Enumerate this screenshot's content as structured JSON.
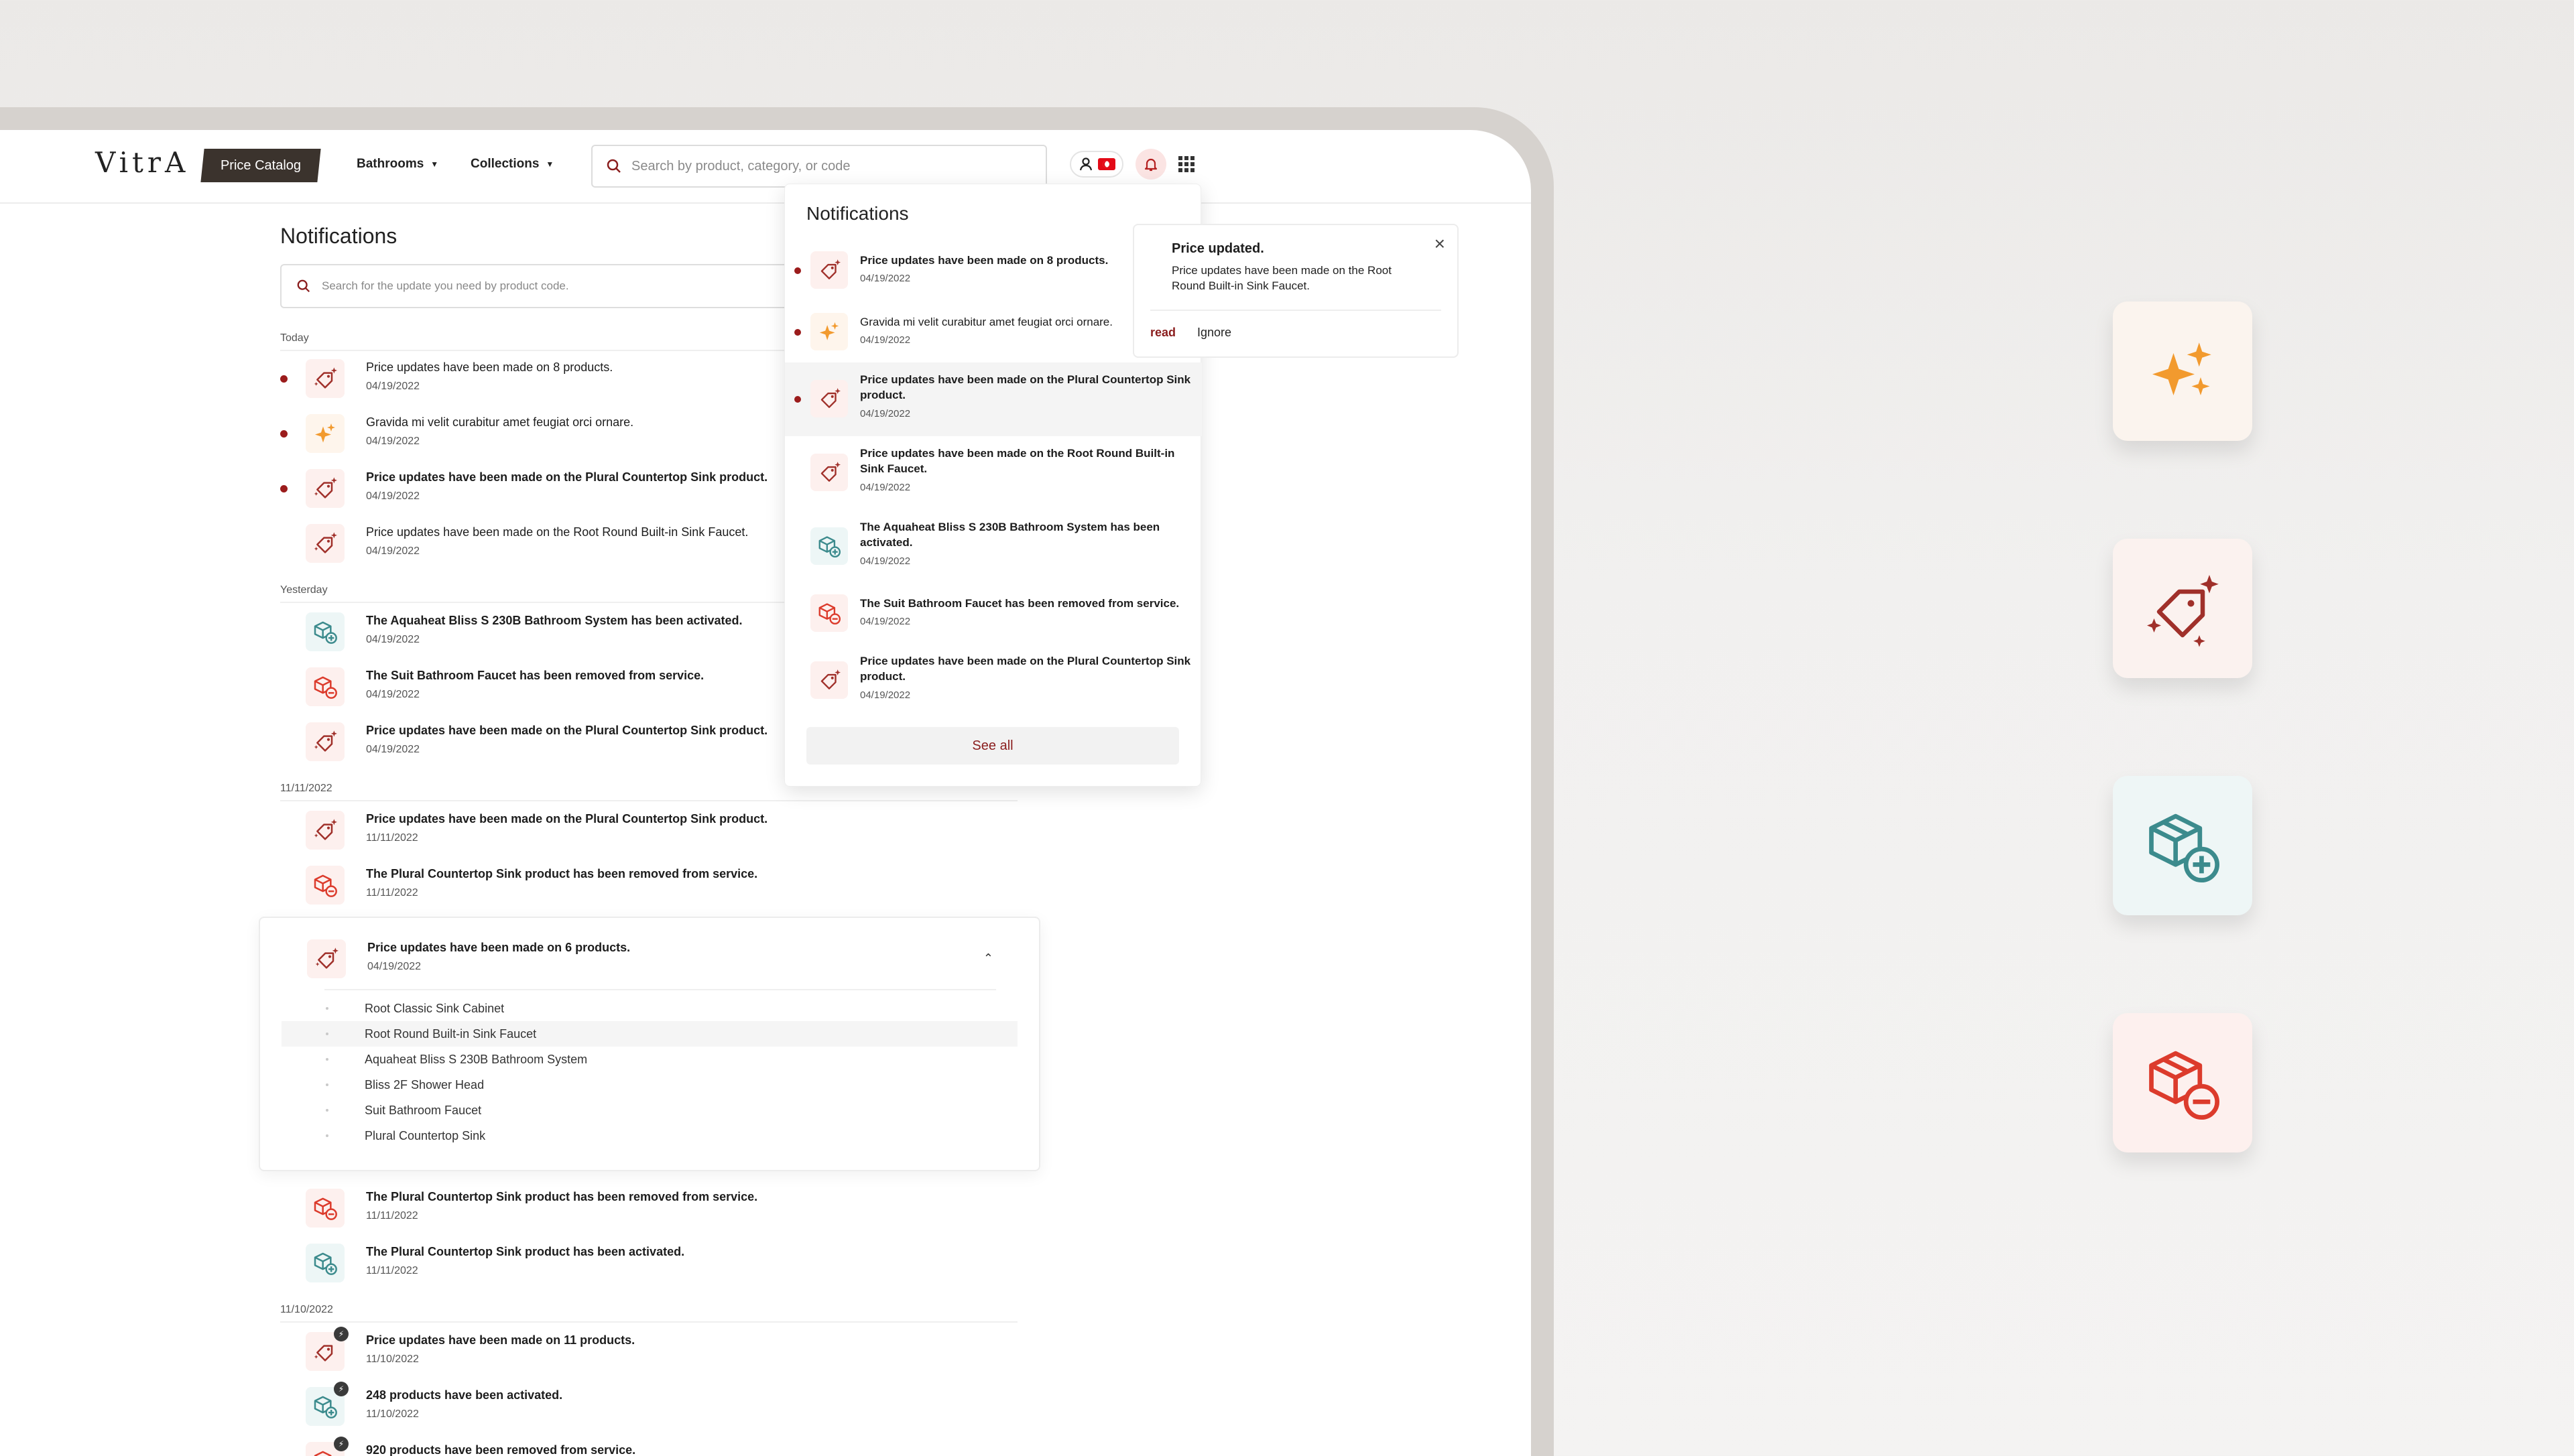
{
  "header": {
    "logo": "VitrA",
    "catalog_badge": "Price Catalog",
    "nav": [
      {
        "label": "Bathrooms"
      },
      {
        "label": "Collections"
      }
    ],
    "search_placeholder": "Search by product, category, or code"
  },
  "page": {
    "title": "Notifications",
    "search_placeholder": "Search for the update you need by product code.",
    "groups": [
      {
        "label": "Today",
        "items": [
          {
            "icon": "price-tag-icon",
            "title": "Price updates have been made on 8 products.",
            "date": "04/19/2022",
            "unread": true
          },
          {
            "icon": "sparkle-icon",
            "title": "Gravida mi velit curabitur amet feugiat orci ornare.",
            "date": "04/19/2022",
            "unread": true
          },
          {
            "icon": "price-tag-icon",
            "title": "Price updates have been made on the Plural Countertop Sink product.",
            "date": "04/19/2022",
            "unread": true
          },
          {
            "icon": "price-tag-icon",
            "title": "Price updates have been made on the Root Round Built-in Sink Faucet.",
            "date": "04/19/2022",
            "unread": false
          }
        ]
      },
      {
        "label": "Yesterday",
        "items": [
          {
            "icon": "box-add-icon",
            "title": "The Aquaheat Bliss S 230B Bathroom System has been activated.",
            "date": "04/19/2022"
          },
          {
            "icon": "box-remove-icon",
            "title": "The Suit Bathroom Faucet has been removed from service.",
            "date": "04/19/2022"
          },
          {
            "icon": "price-tag-icon",
            "title": "Price updates have been made on the Plural Countertop Sink product.",
            "date": "04/19/2022"
          }
        ]
      },
      {
        "label": "11/11/2022",
        "items": [
          {
            "icon": "price-tag-icon",
            "title": "Price updates have been made on the Plural Countertop Sink product.",
            "date": "11/11/2022"
          },
          {
            "icon": "box-remove-icon",
            "title": "The Plural Countertop Sink product has been removed from service.",
            "date": "11/11/2022"
          }
        ]
      }
    ],
    "expanded": {
      "title": "Price updates have been made on 6 products.",
      "date": "04/19/2022",
      "products": [
        "Root Classic Sink Cabinet",
        "Root Round Built-in Sink Faucet",
        "Aquaheat Bliss S 230B Bathroom System",
        "Bliss 2F Shower Head",
        "Suit Bathroom Faucet",
        "Plural Countertop Sink"
      ]
    },
    "after_expanded": [
      {
        "icon": "box-remove-icon",
        "title": "The Plural Countertop Sink product has been removed from service.",
        "date": "11/11/2022"
      },
      {
        "icon": "box-add-icon",
        "title": "The Plural Countertop Sink product has been activated.",
        "date": "11/11/2022"
      }
    ],
    "group_4": {
      "label": "11/10/2022",
      "items": [
        {
          "icon": "price-tag-icon",
          "title": "Price updates have been made on 11 products.",
          "date": "11/10/2022"
        },
        {
          "icon": "box-add-icon",
          "title": "248 products have been activated.",
          "date": "11/10/2022"
        },
        {
          "icon": "box-remove-icon",
          "title": "920 products have been removed from service.",
          "date": ""
        }
      ]
    }
  },
  "dropdown": {
    "title": "Notifications",
    "items": [
      {
        "icon": "price-tag-icon",
        "title": "Price updates have been made on 8 products.",
        "date": "04/19/2022",
        "unread": true,
        "bold": true
      },
      {
        "icon": "sparkle-icon",
        "title": "Gravida mi velit curabitur amet feugiat orci ornare.",
        "date": "04/19/2022",
        "unread": true,
        "bold": false
      },
      {
        "icon": "price-tag-icon",
        "title": "Price updates have been made on the Plural Countertop Sink product.",
        "date": "04/19/2022",
        "unread": true,
        "bold": true
      },
      {
        "icon": "price-tag-icon",
        "title": "Price updates have been made on the Root Round Built-in Sink Faucet.",
        "date": "04/19/2022",
        "unread": false,
        "bold": true
      },
      {
        "icon": "box-add-icon",
        "title": "The Aquaheat Bliss S 230B Bathroom System has been activated.",
        "date": "04/19/2022",
        "unread": false,
        "bold": true
      },
      {
        "icon": "box-remove-icon",
        "title": "The Suit Bathroom Faucet has been removed from service.",
        "date": "04/19/2022",
        "unread": false,
        "bold": true
      },
      {
        "icon": "price-tag-icon",
        "title": "Price updates have been made on the Plural Countertop Sink product.",
        "date": "04/19/2022",
        "unread": false,
        "bold": true
      }
    ],
    "see_all": "See all"
  },
  "toast": {
    "title": "Price updated.",
    "body": "Price updates have been made on the Root Round Built-in Sink Faucet.",
    "action_read": "read",
    "action_ignore": "Ignore"
  },
  "showcase_icons": [
    "sparkle-icon",
    "price-tag-icon",
    "box-add-icon",
    "box-remove-icon"
  ],
  "colors": {
    "brand_dark": "#3b332d",
    "red": "#a0302a",
    "orange": "#f29a2e",
    "teal": "#3c8b8d",
    "coral": "#dc3b2c"
  }
}
